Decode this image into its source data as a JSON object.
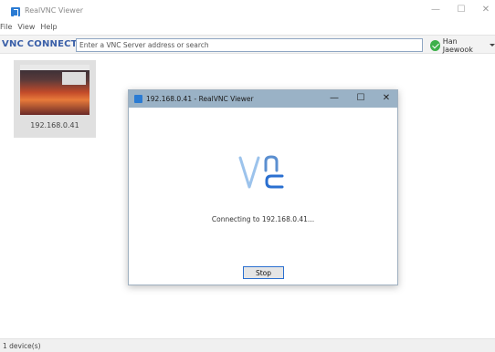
{
  "window": {
    "title": "RealVNC Viewer",
    "minimize_glyph": "—",
    "maximize_glyph": "☐",
    "close_glyph": "✕"
  },
  "menu": [
    "File",
    "View",
    "Help"
  ],
  "toolbar": {
    "brand": "VNC CONNECT",
    "search_placeholder": "Enter a VNC Server address or search",
    "user_name": "Han Jaewook"
  },
  "devices": [
    {
      "label": "192.168.0.41"
    }
  ],
  "dialog": {
    "title": "192.168.0.41 - RealVNC Viewer",
    "logo_text": "VNC",
    "status": "Connecting to 192.168.0.41...",
    "stop_label": "Stop",
    "minimize_glyph": "—",
    "maximize_glyph": "☐",
    "close_glyph": "✕"
  },
  "statusbar": {
    "text": "1 device(s)"
  },
  "colors": {
    "brand": "#3a5fa8",
    "dialog_titlebar": "#9ab2c6",
    "logo_accent": "#6a9fd8",
    "online": "#3db04a"
  }
}
